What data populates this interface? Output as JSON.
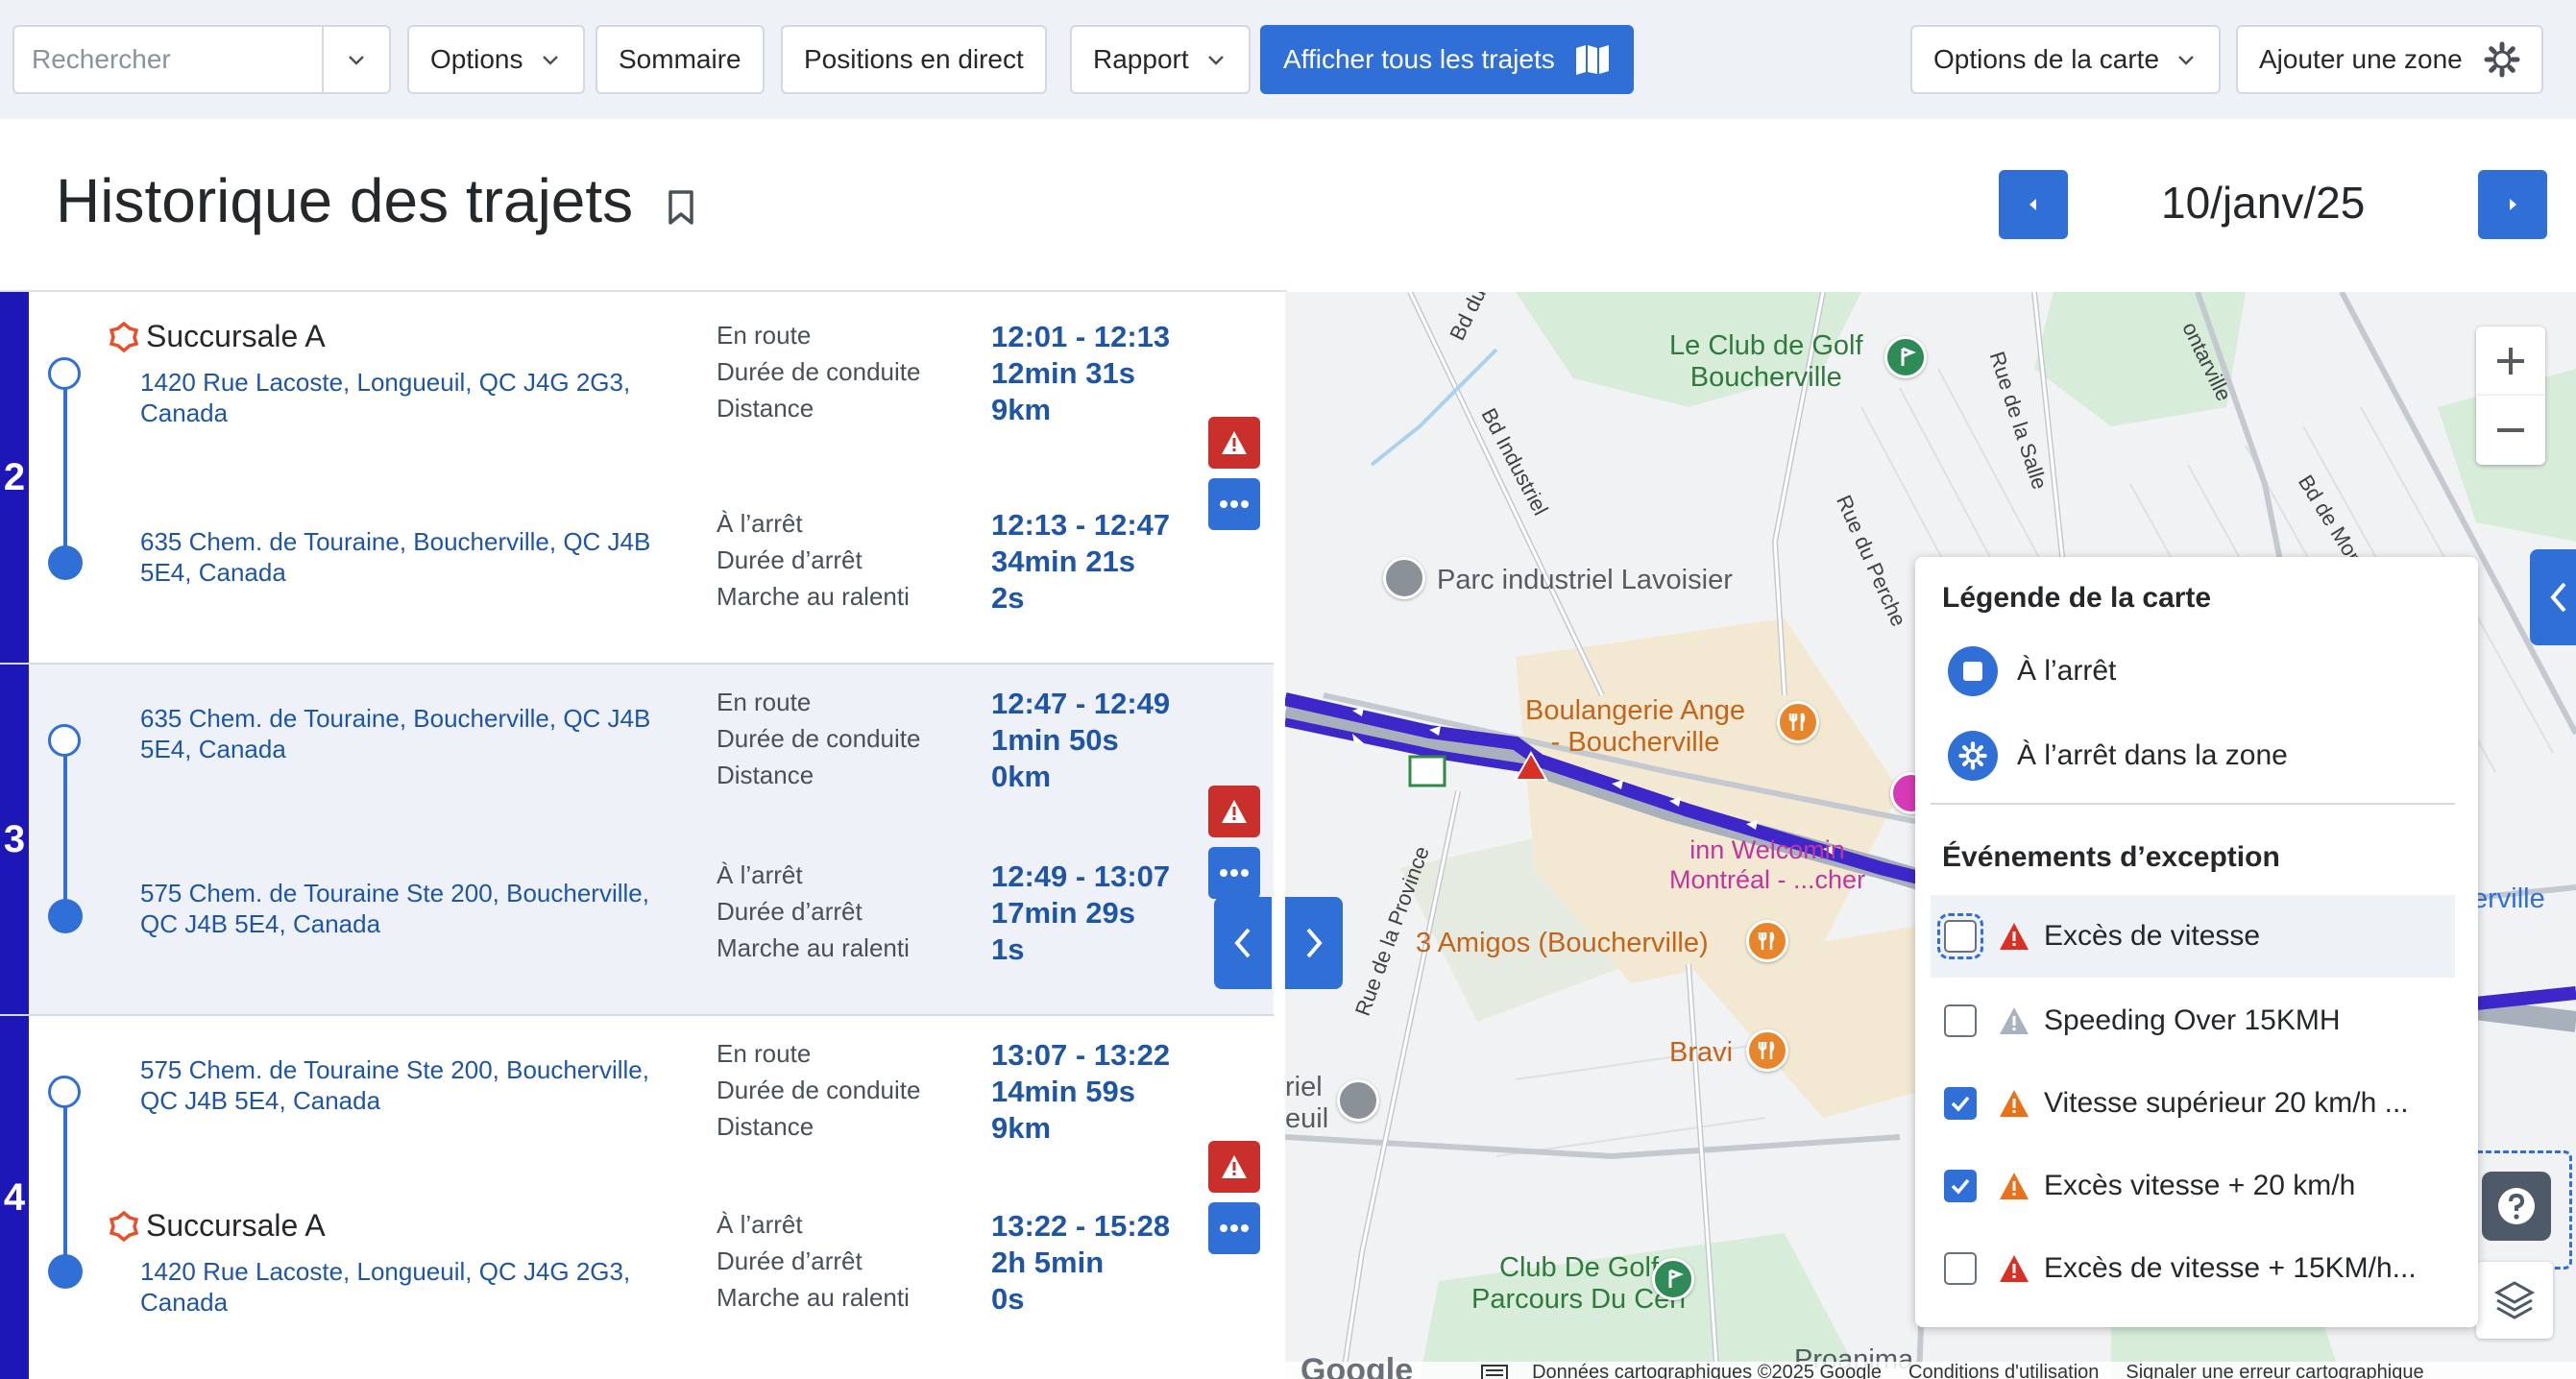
{
  "toolbar": {
    "search_placeholder": "Rechercher",
    "options": "Options",
    "summary": "Sommaire",
    "live_positions": "Positions en direct",
    "report": "Rapport",
    "show_all_trips": "Afficher tous les trajets",
    "map_options": "Options de la carte",
    "add_zone": "Ajouter une zone"
  },
  "header": {
    "title": "Historique des trajets",
    "date": "10/janv/25"
  },
  "labels": {
    "en_route": "En route",
    "drive_duration": "Durée de conduite",
    "distance": "Distance",
    "stopped": "À l’arrêt",
    "stop_duration": "Durée d’arrêt",
    "idling": "Marche au ralenti"
  },
  "trips": [
    {
      "number": "2",
      "start_zone": "Succursale A",
      "start_address": "1420 Rue Lacoste, Longueuil, QC J4G 2G3, Canada",
      "route_time": "12:01 - 12:13",
      "drive_duration": "12min 31s",
      "distance": "9km",
      "end_zone": "",
      "end_address": "635 Chem. de Touraine, Boucherville, QC J4B 5E4, Canada",
      "stop_time": "12:13 - 12:47",
      "stop_duration": "34min 21s",
      "idle": "2s"
    },
    {
      "number": "3",
      "start_zone": "",
      "start_address": "635 Chem. de Touraine, Boucherville, QC J4B 5E4, Canada",
      "route_time": "12:47 - 12:49",
      "drive_duration": "1min 50s",
      "distance": "0km",
      "end_zone": "",
      "end_address": "575 Chem. de Touraine Ste 200, Boucherville, QC J4B 5E4, Canada",
      "stop_time": "12:49 - 13:07",
      "stop_duration": "17min 29s",
      "idle": "1s"
    },
    {
      "number": "4",
      "start_zone": "",
      "start_address": "575 Chem. de Touraine Ste 200, Boucherville, QC J4B 5E4, Canada",
      "route_time": "13:07 - 13:22",
      "drive_duration": "14min 59s",
      "distance": "9km",
      "end_zone": "Succursale A",
      "end_address": "1420 Rue Lacoste, Longueuil, QC J4G 2G3, Canada",
      "stop_time": "13:22 - 15:28",
      "stop_duration": "2h 5min",
      "idle": "0s"
    }
  ],
  "map": {
    "labels": {
      "golf_1": "Le Club de Golf\nBoucherville",
      "parc": "Parc industriel Lavoisier",
      "boulangerie": "Boulangerie Ange\n- Boucherville",
      "welcomin": "inn Welcomin\nMontréal - ...cher",
      "amigos": "3 Amigos (Boucherville)",
      "bravi": "Bravi",
      "golf_2": "Club De Golf\nParcours Du Cerf",
      "proanima": "Proanima",
      "riel": "riel\neuil",
      "erville": "erville"
    },
    "streets": {
      "bd_du": "Bd du",
      "bd_industriel": "Bd Industriel",
      "rue_salle": "Rue de la Salle",
      "montarville": "ontarville",
      "bd_monte": "Bd de Monte",
      "rue_perche": "Rue du Perche",
      "rue_province": "Rue de la Province"
    },
    "attribution": {
      "brand": "Google",
      "data": "Données cartographiques ©2025 Google",
      "terms": "Conditions d'utilisation",
      "report": "Signaler une erreur cartographique"
    }
  },
  "legend": {
    "title": "Légende de la carte",
    "stopped": "À l’arrêt",
    "stopped_zone": "À l’arrêt dans la zone",
    "exceptions_title": "Événements d’exception",
    "exceptions": [
      {
        "label": "Excès de vitesse",
        "checked": false,
        "color": "#d93025"
      },
      {
        "label": "Speeding Over 15KMH",
        "checked": false,
        "color": "#aab3bd"
      },
      {
        "label": "Vitesse supérieur 20 km/h ...",
        "checked": true,
        "color": "#e8711a"
      },
      {
        "label": "Excès vitesse + 20 km/h",
        "checked": true,
        "color": "#e8711a"
      },
      {
        "label": "Excès de vitesse + 15KM/h...",
        "checked": false,
        "color": "#d93025"
      }
    ]
  },
  "colors": {
    "primary": "#2f6fd6",
    "trip_bar": "#1d17b8",
    "alert": "#c9302c",
    "route": "#3d27c9",
    "link": "#1f55a5"
  }
}
